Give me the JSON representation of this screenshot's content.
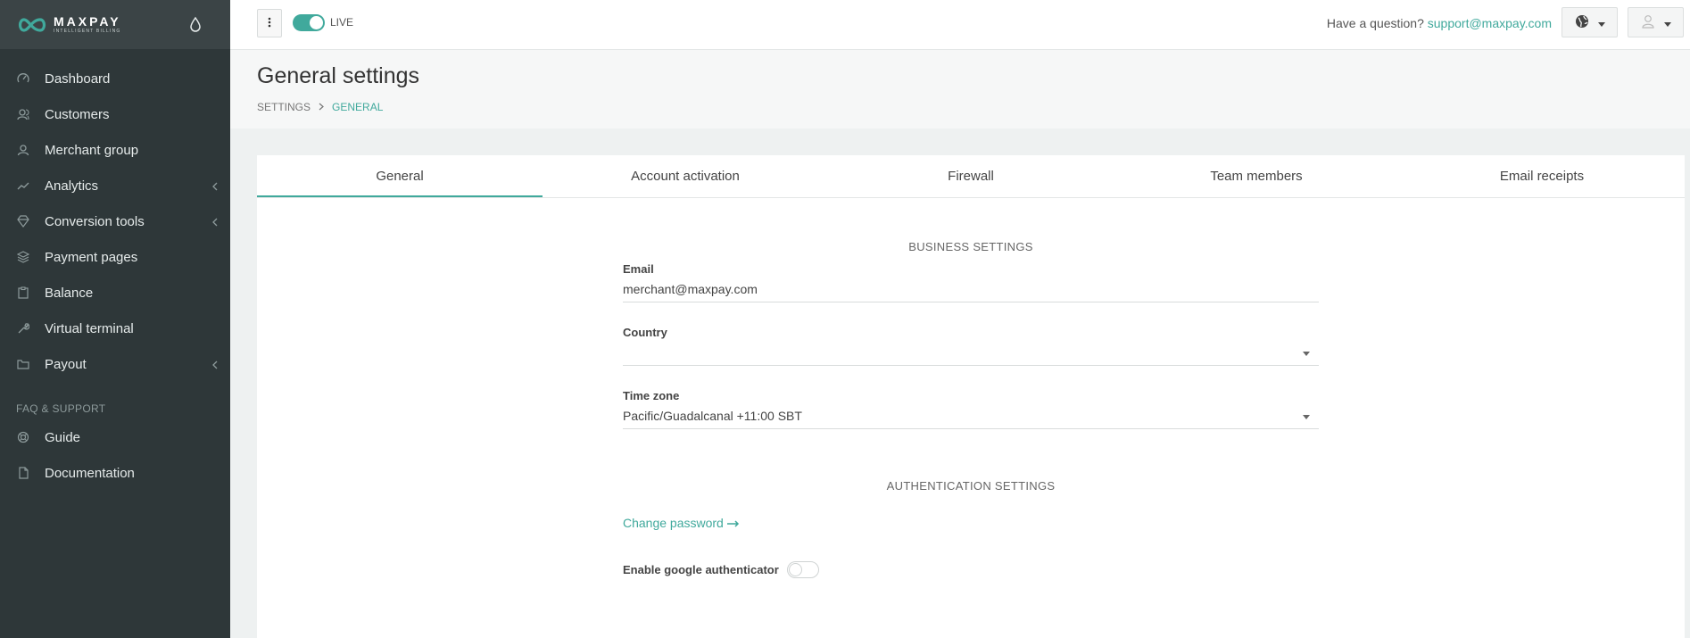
{
  "brand": {
    "name": "MAXPAY",
    "tagline": "INTELLIGENT BILLING",
    "accent": "#40a99c",
    "sidebar_bg": "#2e3739"
  },
  "sidebar": {
    "items": [
      {
        "label": "Dashboard",
        "icon": "gauge-icon"
      },
      {
        "label": "Customers",
        "icon": "users-icon"
      },
      {
        "label": "Merchant group",
        "icon": "user-icon"
      },
      {
        "label": "Analytics",
        "icon": "chart-line-icon",
        "has_submenu": true
      },
      {
        "label": "Conversion tools",
        "icon": "diamond-icon",
        "has_submenu": true
      },
      {
        "label": "Payment pages",
        "icon": "layers-icon"
      },
      {
        "label": "Balance",
        "icon": "clipboard-icon"
      },
      {
        "label": "Virtual terminal",
        "icon": "wrench-icon"
      },
      {
        "label": "Payout",
        "icon": "folder-icon",
        "has_submenu": true
      }
    ],
    "section_label": "FAQ & SUPPORT",
    "support_items": [
      {
        "label": "Guide",
        "icon": "lifebuoy-icon"
      },
      {
        "label": "Documentation",
        "icon": "document-icon"
      }
    ]
  },
  "topbar": {
    "mode_label": "LIVE",
    "mode_on": true,
    "question_text": "Have a question?",
    "support_email": "support@maxpay.com"
  },
  "page": {
    "title": "General settings",
    "breadcrumb": [
      "SETTINGS",
      "GENERAL"
    ]
  },
  "tabs": [
    {
      "label": "General",
      "active": true
    },
    {
      "label": "Account activation"
    },
    {
      "label": "Firewall"
    },
    {
      "label": "Team members"
    },
    {
      "label": "Email receipts"
    }
  ],
  "business": {
    "title": "BUSINESS SETTINGS",
    "email_label": "Email",
    "email_value": "merchant@maxpay.com",
    "country_label": "Country",
    "country_value": "",
    "timezone_label": "Time zone",
    "timezone_value": "Pacific/Guadalcanal +11:00 SBT"
  },
  "auth": {
    "title": "AUTHENTICATION SETTINGS",
    "change_password": "Change password",
    "google_auth_label": "Enable google authenticator",
    "google_auth_on": false
  }
}
